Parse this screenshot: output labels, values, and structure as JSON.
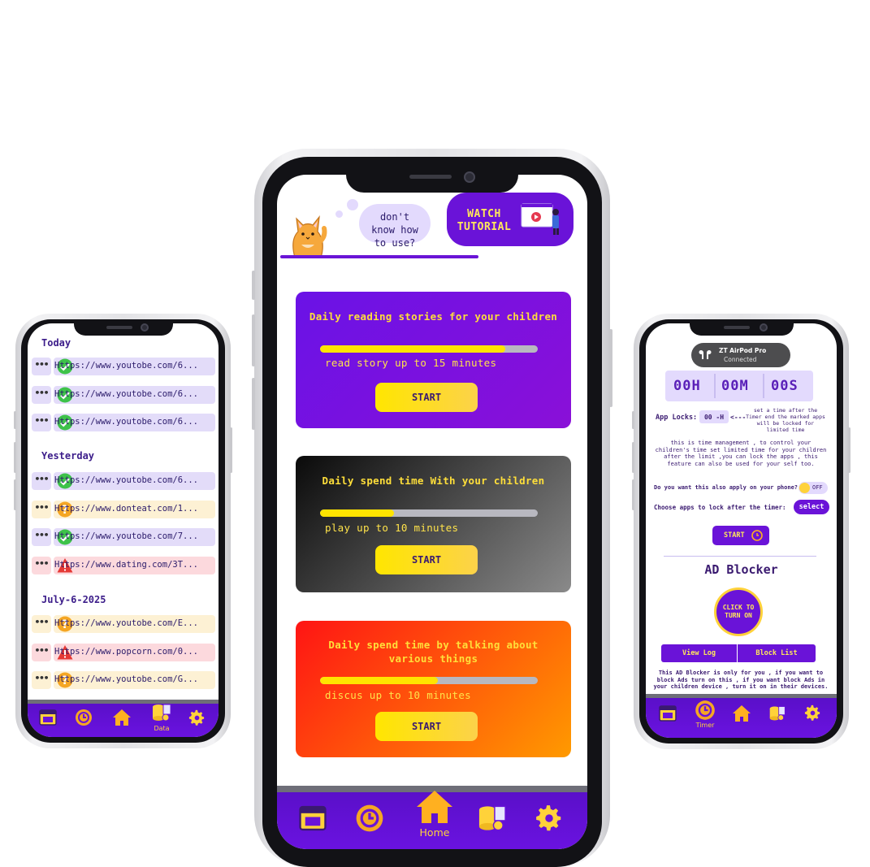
{
  "history": {
    "sections": [
      {
        "label": "Today",
        "rows": [
          {
            "status": "ok",
            "url": "Https://www.youtobe.com/6..."
          },
          {
            "status": "ok",
            "url": "Https://www.youtobe.com/6..."
          },
          {
            "status": "ok",
            "url": "Https://www.youtobe.com/6..."
          }
        ]
      },
      {
        "label": "Yesterday",
        "rows": [
          {
            "status": "ok",
            "url": "Https://www.youtobe.com/6..."
          },
          {
            "status": "warn",
            "url": "Https://www.donteat.com/1..."
          },
          {
            "status": "ok",
            "url": "Https://www.youtobe.com/7..."
          },
          {
            "status": "bad",
            "url": "Https://www.dating.com/3T..."
          }
        ]
      },
      {
        "label": "July-6-2025",
        "rows": [
          {
            "status": "warn",
            "url": "Https://www.youtobe.com/E..."
          },
          {
            "status": "bad",
            "url": "Https://www.popcorn.com/0..."
          },
          {
            "status": "warn",
            "url": "Https://www.youtobe.com/G..."
          }
        ]
      }
    ],
    "row_menu": "•••",
    "nav_active_label": "Data"
  },
  "home": {
    "bubble_text": "don't know how to use?",
    "tutorial_label": "WATCH TUTORIAL",
    "cards": [
      {
        "title": "Daily reading stories for your children",
        "subtitle": "read story up to 15 minutes",
        "progress": 0.85,
        "button": "START",
        "gradient": [
          "#6a12e6",
          "#8a10d8"
        ]
      },
      {
        "title": "Daily spend time With your children",
        "subtitle": "play up to 10 minutes",
        "progress": 0.34,
        "button": "START",
        "gradient": [
          "#0a0a0a",
          "#8a8a8a"
        ]
      },
      {
        "title": "Daily spend time by talking about various things",
        "subtitle": "discus up to 10 minutes",
        "progress": 0.54,
        "button": "START",
        "gradient": [
          "#ff1414",
          "#ff9a00"
        ]
      }
    ],
    "nav_active_label": "Home"
  },
  "timer_screen": {
    "airpod_name": "ZT AirPod Pro",
    "airpod_status": "Connected",
    "hours": "00H",
    "minutes": "00M",
    "seconds": "00S",
    "app_locks_label": "App Locks:",
    "app_locks_value": "00 -H",
    "arrow": "<---",
    "app_locks_hint": "set a time after the Timer end the marked apps will be locked for limited time",
    "description": "this is time management , to control your children's time set limited time for your children after the limit ,you can lock the apps , this feature can also be used for your self too.",
    "apply_phone_question": "Do you want this also apply on your phone?",
    "toggle_label": "OFF",
    "choose_apps_label": "Choose apps to lock after the timer:",
    "select_button": "select",
    "start_button": "START",
    "ad_blocker_title": "AD Blocker",
    "turn_on_button": "CLICK TO TURN ON",
    "view_log": "View Log",
    "block_list": "Block List",
    "ad_blocker_note": "This AD Blocker is only for you , if you want to block Ads turn on this , if you want block Ads in your children device , turn it on in their devices.",
    "nav_active_label": "Timer"
  },
  "colors": {
    "primary": "#6a13d8",
    "accent": "#ffd23a",
    "ok": "#3ec24a",
    "warn": "#f5a623",
    "bad": "#e53935"
  }
}
